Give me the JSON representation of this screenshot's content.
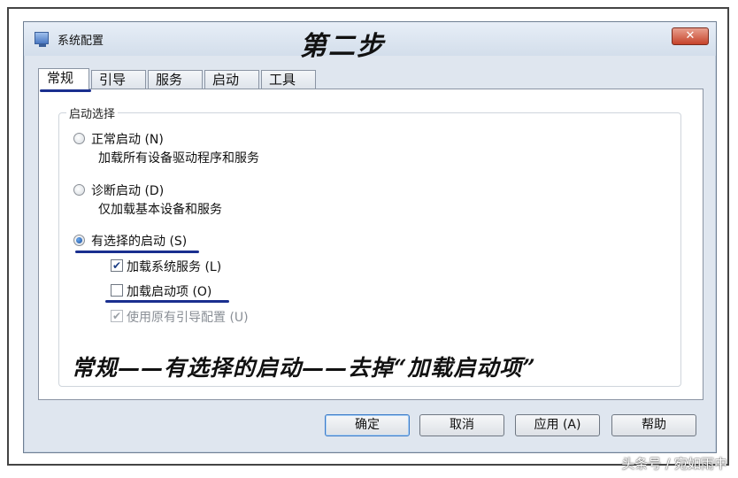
{
  "window": {
    "title": "系统配置",
    "step_title": "第二步",
    "close_label": "✕"
  },
  "tabs": [
    {
      "label": "常规",
      "active": true
    },
    {
      "label": "引导"
    },
    {
      "label": "服务"
    },
    {
      "label": "启动"
    },
    {
      "label": "工具"
    }
  ],
  "startup_selection": {
    "group_title": "启动选择",
    "normal": {
      "label": "正常启动 (N)",
      "description": "加载所有设备驱动程序和服务",
      "checked": false
    },
    "diagnostic": {
      "label": "诊断启动 (D)",
      "description": "仅加载基本设备和服务",
      "checked": false
    },
    "selective": {
      "label": "有选择的启动 (S)",
      "checked": true,
      "options": [
        {
          "label": "加载系统服务 (L)",
          "checked": true,
          "enabled": true
        },
        {
          "label": "加载启动项 (O)",
          "checked": false,
          "enabled": true
        },
        {
          "label": "使用原有引导配置 (U)",
          "checked": true,
          "enabled": false
        }
      ]
    }
  },
  "annotation": "常规——有选择的启动——去掉“加载启动项”",
  "buttons": {
    "ok": "确定",
    "cancel": "取消",
    "apply": "应用 (A)",
    "help": "帮助"
  },
  "watermark": "头条号 / 宛如雨中",
  "colors": {
    "annotation_line": "#1a2f8f",
    "close_button": "#c6432a"
  }
}
